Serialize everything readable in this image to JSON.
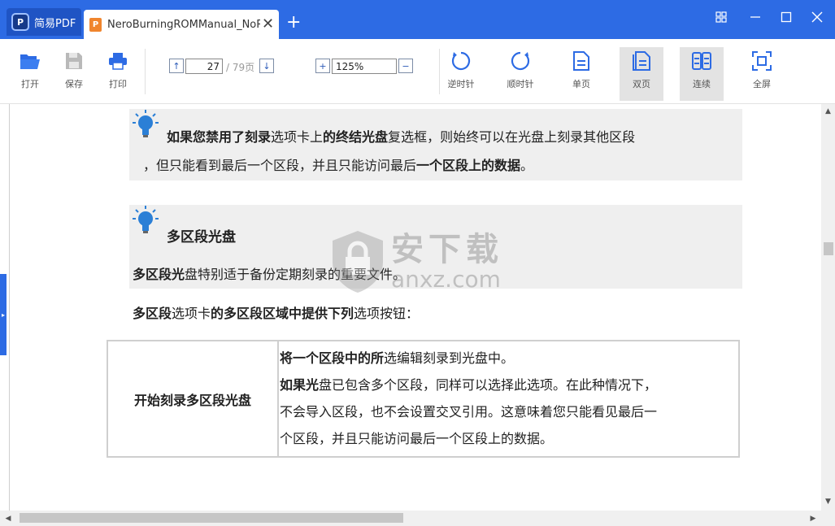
{
  "titlebar": {
    "app_name": "简易PDF",
    "app_logo_glyph": "P",
    "doc_tab_icon_glyph": "P",
    "doc_tab_title": "NeroBurningROMManual_NoRes",
    "new_tab_glyph": "+",
    "colors": {
      "bar": "#2d6be4",
      "app_tab": "#1f54c4",
      "doc_icon": "#f0852d"
    }
  },
  "toolbar": {
    "open_label": "打开",
    "save_label": "保存",
    "print_label": "打印",
    "page_up_glyph": "↑",
    "page_down_glyph": "↓",
    "current_page": "27",
    "total_pages": "/ 79页",
    "zoom_in_glyph": "+",
    "zoom_out_glyph": "−",
    "zoom_value": "125%",
    "rotate_ccw_label": "逆时针",
    "rotate_cw_label": "顺时针",
    "single_page_label": "单页",
    "double_page_label": "双页",
    "continuous_label": "连续",
    "fullscreen_label": "全屏"
  },
  "document": {
    "tip1": {
      "line1": [
        {
          "t": "如果您禁用了刻录",
          "b": true
        },
        {
          "t": "选项卡上",
          "b": false
        },
        {
          "t": "的终结光盘",
          "b": true
        },
        {
          "t": "复",
          "b": false
        },
        {
          "t": "选框，则始终可以在光盘上刻录其他区段",
          "b": false
        }
      ],
      "line2": [
        {
          "t": "，但只能看到最后一个区段，并且只能访问最后",
          "b": false
        },
        {
          "t": "一个区段上的数据",
          "b": true
        },
        {
          "t": "。",
          "b": false
        }
      ]
    },
    "tip2": {
      "heading": "多区段光盘",
      "line1": [
        {
          "t": "多区段光",
          "b": true
        },
        {
          "t": "盘特别适于备份定期刻录的重要文件。",
          "b": false
        }
      ]
    },
    "para": [
      {
        "t": "多区段",
        "b": true
      },
      {
        "t": "选项卡",
        "b": false
      },
      {
        "t": "的多区段区域中提供下列",
        "b": true
      },
      {
        "t": "选项按钮：",
        "b": false
      }
    ],
    "table": {
      "left": "开始刻录多区段光盘",
      "right": [
        [
          {
            "t": "将一个区段中的所",
            "b": true
          },
          {
            "t": "选编辑刻录到光盘中。",
            "b": false
          }
        ],
        [
          {
            "t": "如果光",
            "b": true
          },
          {
            "t": "盘已包含多个区段，同样可以选择此选项。在此种情况下，",
            "b": false
          }
        ],
        [
          {
            "t": "不会导入区段，也不会设置交叉引用。这意味着您只能看见最后一",
            "b": false
          }
        ],
        [
          {
            "t": "个区段，并且只能访问最后一个区段上的数据。",
            "b": false
          }
        ]
      ]
    }
  },
  "watermark": {
    "cn": "安下载",
    "en": "anxz.com"
  },
  "scroll": {
    "up_glyph": "▲",
    "down_glyph": "▼",
    "left_glyph": "◀",
    "right_glyph": "▶",
    "side_glyph": "▸"
  },
  "icons": {
    "tip": "lightbulb-icon",
    "open": "folder-open-icon",
    "save": "floppy-disk-icon",
    "print": "printer-icon"
  }
}
